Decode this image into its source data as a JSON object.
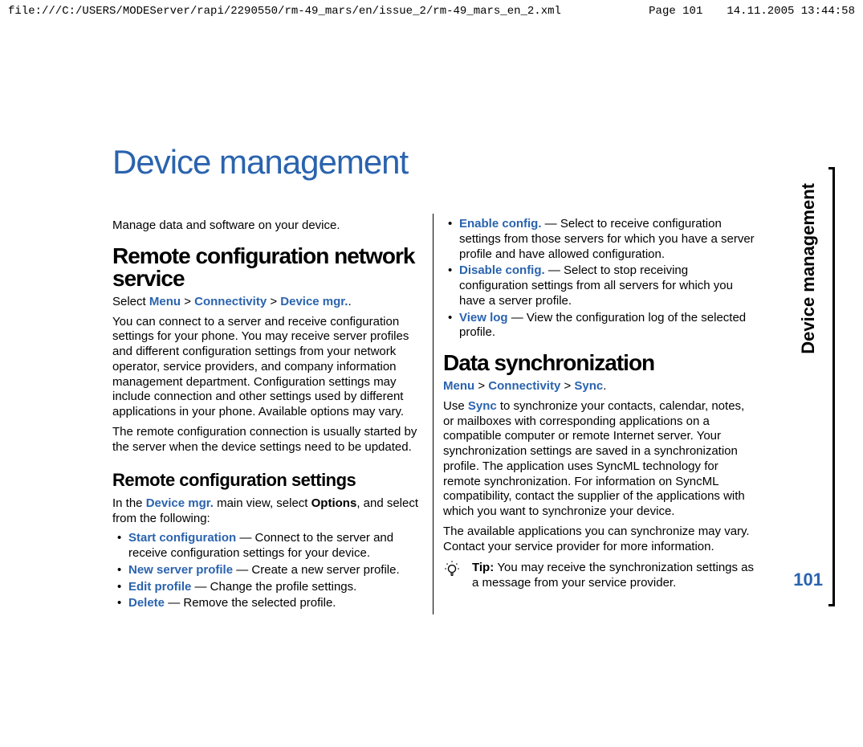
{
  "header": {
    "path": "file:///C:/USERS/MODEServer/rapi/2290550/rm-49_mars/en/issue_2/rm-49_mars_en_2.xml",
    "page": "Page 101",
    "timestamp": "14.11.2005 13:44:58"
  },
  "sidebar": {
    "label": "Device management",
    "page_number": "101"
  },
  "title": "Device management",
  "left": {
    "intro": "Manage data and software on your device.",
    "remote_config_heading": "Remote configuration network service",
    "select_prefix": "Select ",
    "nav_menu": "Menu",
    "nav_gt": " > ",
    "nav_connectivity": "Connectivity",
    "nav_device_mgr": "Device mgr.",
    "select_suffix": ".",
    "para1": "You can connect to a server and receive configuration settings for your phone. You may receive server profiles and different configuration settings from your network operator, service providers, and company information management department. Configuration settings may include connection and other settings used by different applications in your phone. Available options may vary.",
    "para2": "The remote configuration connection is usually started by the server when the device settings need to be updated.",
    "settings_heading": "Remote configuration settings",
    "settings_intro1": "In the ",
    "settings_intro_link": "Device mgr.",
    "settings_intro2": " main view, select ",
    "settings_intro_bold": "Options",
    "settings_intro3": ", and select from the following:",
    "items": [
      {
        "label": "Start configuration",
        "desc": " — Connect to the server and receive configuration settings for your device."
      },
      {
        "label": "New server profile",
        "desc": " — Create a new server profile."
      },
      {
        "label": "Edit profile",
        "desc": " — Change the profile settings."
      },
      {
        "label": "Delete",
        "desc": " — Remove the selected profile."
      }
    ]
  },
  "right": {
    "items": [
      {
        "label": "Enable config.",
        "desc": " — Select to receive configuration settings from those servers for which you have a server profile and have allowed configuration."
      },
      {
        "label": "Disable config.",
        "desc": " — Select to stop receiving configuration settings from all servers for which you have a server profile."
      },
      {
        "label": "View log",
        "desc": " — View the configuration log of the selected profile."
      }
    ],
    "data_sync_heading": "Data synchronization",
    "nav_menu": "Menu",
    "nav_gt": " > ",
    "nav_connectivity": "Connectivity",
    "nav_sync": "Sync",
    "nav_suffix": ".",
    "use_prefix": "Use ",
    "use_link": "Sync",
    "use_body": " to synchronize your contacts, calendar, notes, or mailboxes with corresponding applications on a compatible computer or remote Internet server. Your synchronization settings are saved in a synchronization profile. The application uses SyncML technology for remote synchronization. For information on SyncML compatibility, contact the supplier of the applications with which you want to synchronize your device.",
    "para3": "The available applications you can synchronize may vary. Contact your service provider for more information.",
    "tip_label": "Tip: ",
    "tip_text": "You may receive the synchronization settings as a message from your service provider."
  }
}
